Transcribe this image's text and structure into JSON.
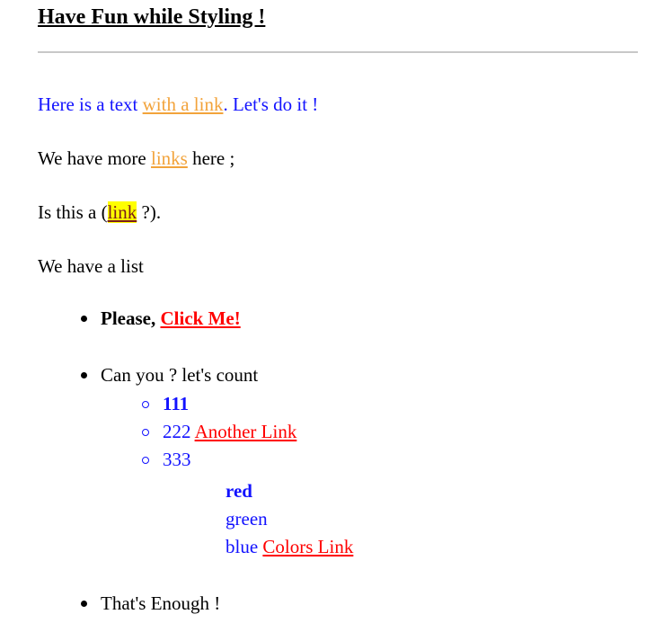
{
  "heading": "Have Fun while Styling !",
  "para1": {
    "before": "Here is a text ",
    "link": "with a link",
    "after": ". Let's do it !"
  },
  "para2": {
    "before": "We have more ",
    "link": "links",
    "after": " here ;"
  },
  "para3": {
    "before": "Is this a (",
    "link": "link",
    "after": " ?)."
  },
  "para4": "We have a list",
  "list": {
    "item1": {
      "text": "Please, ",
      "link": "Click Me!"
    },
    "item2": {
      "text": "Can you ? let's count",
      "sub": {
        "n1": "111",
        "n2": "222",
        "n2_link": "Another Link",
        "n3": "333",
        "colors": {
          "c1": "red",
          "c2": "green",
          "c3": "blue",
          "c3_link": "Colors Link"
        }
      }
    },
    "item3": "That's Enough !"
  },
  "colors": {
    "text_blue": "#1212ff",
    "link_orange": "#f2a33b",
    "link_red": "#ff0000",
    "highlight": "#ffff00"
  }
}
